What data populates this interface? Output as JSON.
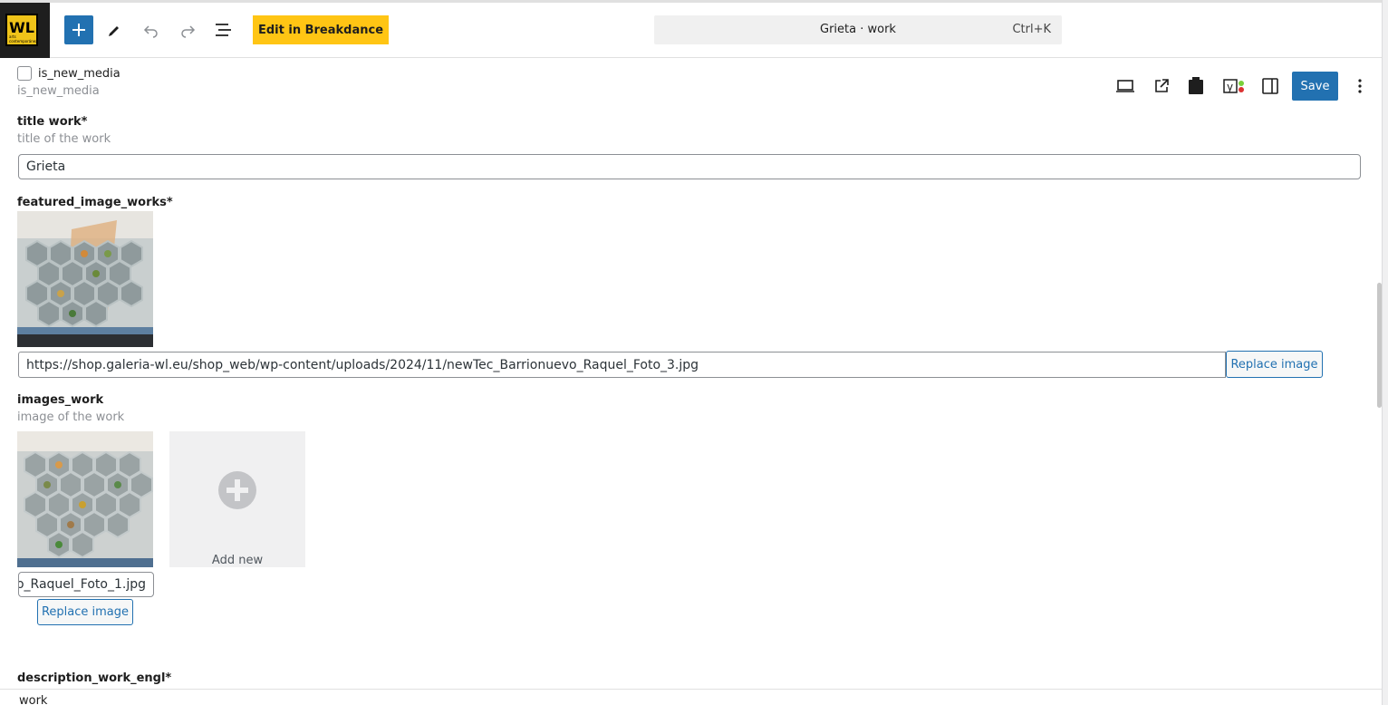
{
  "toolbar": {
    "logo_text": "WL",
    "logo_subtext": "arts contemporánea",
    "breakdance_label": "Edit in Breakdance",
    "command_title": "Grieta · work",
    "command_shortcut": "Ctrl+K"
  },
  "actions": {
    "save_label": "Save"
  },
  "fields": {
    "is_new_media": {
      "checkbox_label": "is_new_media",
      "description": "is_new_media"
    },
    "title_work": {
      "label": "title work*",
      "description": "title of the work",
      "value": "Grieta"
    },
    "featured_image": {
      "label": "featured_image_works*",
      "url_value": "https://shop.galeria-wl.eu/shop_web/wp-content/uploads/2024/11/newTec_Barrionuevo_Raquel_Foto_3.jpg",
      "replace_label": "Replace image"
    },
    "images_work": {
      "label": "images_work",
      "description": "image of the work",
      "filename_value": "o_Raquel_Foto_1.jpg",
      "replace_label": "Replace image",
      "add_new_label": "Add new"
    },
    "description_engl": {
      "label": "description_work_engl*"
    }
  },
  "bottom": {
    "breadcrumb": "work"
  },
  "colors": {
    "primary": "#2271b1",
    "breakdance": "#ffc514",
    "logo_bg": "#f0c419"
  }
}
